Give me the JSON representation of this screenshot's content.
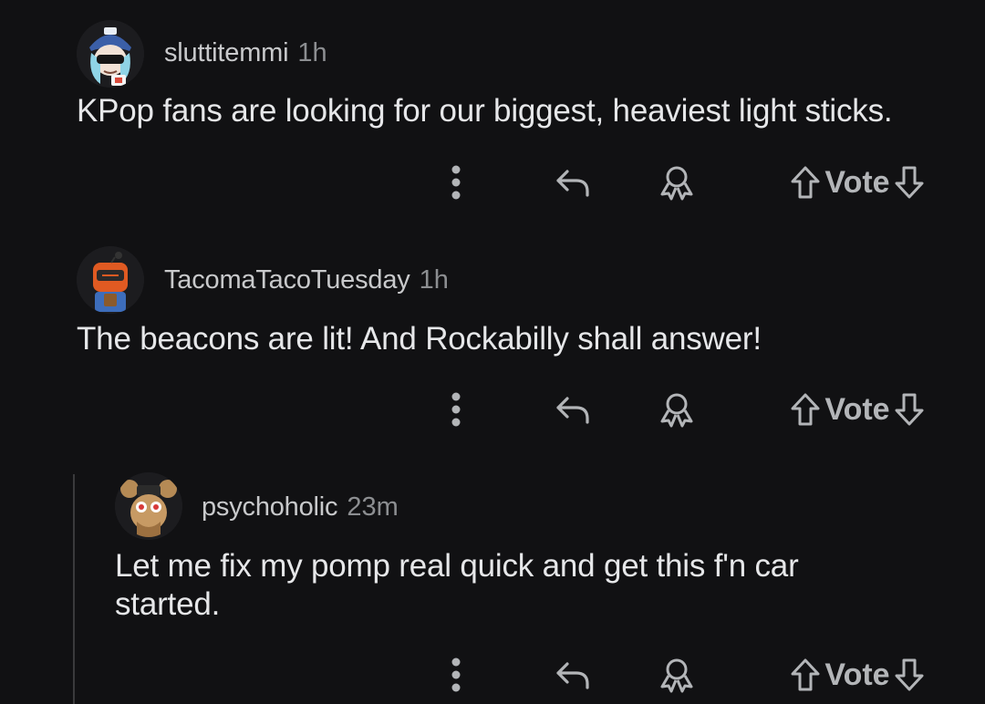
{
  "theme": {
    "background": "#111113",
    "text_primary": "#e6e7e9",
    "text_secondary": "#8c8e91",
    "icon_color": "#b3b5b8"
  },
  "comments": [
    {
      "username": "sluttitemmi",
      "time": "1h",
      "body": "KPop fans are looking for our biggest, heaviest light sticks.",
      "avatar": "avatar-icon",
      "actions": {
        "more": "more-options-icon",
        "reply": "reply-icon",
        "award": "award-icon",
        "upvote": "upvote-icon",
        "vote_label": "Vote",
        "downvote": "downvote-icon"
      }
    },
    {
      "username": "TacomaTacoTuesday",
      "time": "1h",
      "body": "The beacons are lit! And Rockabilly shall answer!",
      "avatar": "avatar-icon",
      "actions": {
        "more": "more-options-icon",
        "reply": "reply-icon",
        "award": "award-icon",
        "upvote": "upvote-icon",
        "vote_label": "Vote",
        "downvote": "downvote-icon"
      }
    },
    {
      "username": "psychoholic",
      "time": "23m",
      "body_line1": "Let me fix my pomp real quick and get this f'n car",
      "body_line2": "started.",
      "avatar": "avatar-icon",
      "actions": {
        "more": "more-options-icon",
        "reply": "reply-icon",
        "award": "award-icon",
        "upvote": "upvote-icon",
        "vote_label": "Vote",
        "downvote": "downvote-icon"
      }
    }
  ]
}
